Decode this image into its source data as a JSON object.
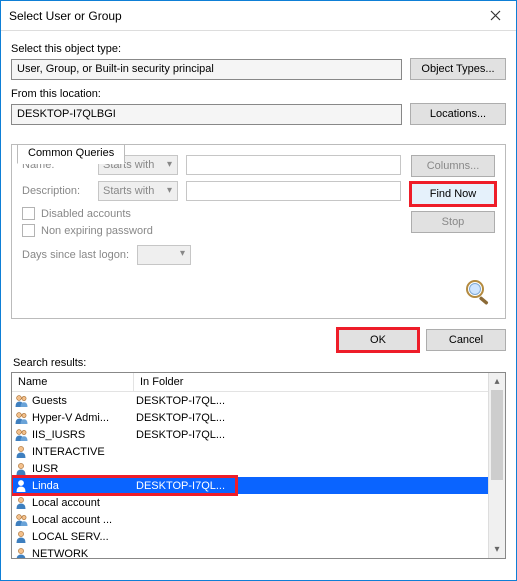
{
  "window": {
    "title": "Select User or Group"
  },
  "section": {
    "objectTypeLabel": "Select this object type:",
    "objectTypeValue": "User, Group, or Built-in security principal",
    "objectTypesBtn": "Object Types...",
    "locationLabel": "From this location:",
    "locationValue": "DESKTOP-I7QLBGI",
    "locationsBtn": "Locations..."
  },
  "tab": {
    "label": "Common Queries"
  },
  "queries": {
    "nameLabel": "Name:",
    "nameMode": "Starts with",
    "descLabel": "Description:",
    "descMode": "Starts with",
    "disabled": "Disabled accounts",
    "nonexp": "Non expiring password",
    "daysLabel": "Days since last logon:"
  },
  "sideButtons": {
    "columns": "Columns...",
    "findNow": "Find Now",
    "stop": "Stop"
  },
  "footer": {
    "ok": "OK",
    "cancel": "Cancel"
  },
  "search": {
    "label": "Search results:",
    "columns": {
      "name": "Name",
      "folder": "In Folder"
    },
    "rows": [
      {
        "icon": "group",
        "name": "Guests",
        "folder": "DESKTOP-I7QL...",
        "sel": false
      },
      {
        "icon": "group",
        "name": "Hyper-V Admi...",
        "folder": "DESKTOP-I7QL...",
        "sel": false
      },
      {
        "icon": "group",
        "name": "IIS_IUSRS",
        "folder": "DESKTOP-I7QL...",
        "sel": false
      },
      {
        "icon": "user",
        "name": "INTERACTIVE",
        "folder": "",
        "sel": false
      },
      {
        "icon": "user",
        "name": "IUSR",
        "folder": "",
        "sel": false
      },
      {
        "icon": "user",
        "name": "Linda",
        "folder": "DESKTOP-I7QL...",
        "sel": true
      },
      {
        "icon": "user",
        "name": "Local account",
        "folder": "",
        "sel": false
      },
      {
        "icon": "group",
        "name": "Local account ...",
        "folder": "",
        "sel": false
      },
      {
        "icon": "user",
        "name": "LOCAL SERV...",
        "folder": "",
        "sel": false
      },
      {
        "icon": "user",
        "name": "NETWORK",
        "folder": "",
        "sel": false
      }
    ]
  }
}
